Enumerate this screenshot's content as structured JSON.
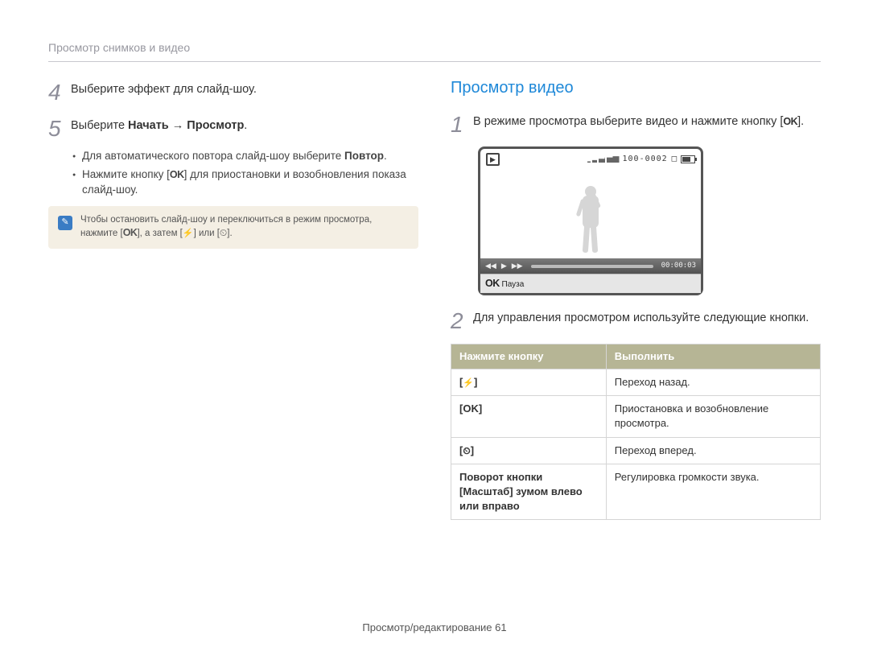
{
  "header": "Просмотр снимков и видео",
  "left": {
    "step4": {
      "num": "4",
      "text": "Выберите эффект для слайд-шоу."
    },
    "step5": {
      "num": "5",
      "prefix": "Выберите ",
      "bold1": "Начать",
      "arrow": " → ",
      "bold2": "Просмотр",
      "suffix": "."
    },
    "sub1_prefix": "Для автоматического повтора слайд-шоу выберите ",
    "sub1_bold": "Повтор",
    "sub1_suffix": ".",
    "sub2_part1": "Нажмите кнопку [",
    "sub2_key": "OK",
    "sub2_part2": "] для приостановки и возобновления показа слайд-шоу.",
    "note_line1": "Чтобы остановить слайд-шоу и переключиться в режим просмотра,",
    "note_line2_a": "нажмите [",
    "note_line2_key1": "OK",
    "note_line2_b": "], а затем [",
    "note_line2_c": "] или [",
    "note_line2_d": "]."
  },
  "right": {
    "title": "Просмотр видео",
    "step1": {
      "num": "1",
      "part1": "В режиме просмотра выберите видео и нажмите кнопку [",
      "key": "OK",
      "part2": "]."
    },
    "preview": {
      "counter": "100-0002",
      "time": "00:00:03",
      "footerKey": "OK",
      "footerLabel": " Пауза"
    },
    "step2": {
      "num": "2",
      "text": "Для управления просмотром используйте следующие кнопки."
    },
    "table": {
      "head1": "Нажмите кнопку",
      "head2": "Выполнить",
      "rows": [
        {
          "key": "[⚡]",
          "keyType": "flash",
          "action": "Переход назад."
        },
        {
          "key": "[OK]",
          "keyType": "ok",
          "action": "Приостановка и возобновление просмотра."
        },
        {
          "key": "[⏲]",
          "keyType": "timer",
          "action": "Переход вперед."
        },
        {
          "key": "Поворот кнопки [Масштаб] зумом влево или вправо",
          "keyType": "text",
          "action": "Регулировка громкости звука."
        }
      ]
    }
  },
  "footer": {
    "text": "Просмотр/редактирование  ",
    "pageNum": "61"
  }
}
